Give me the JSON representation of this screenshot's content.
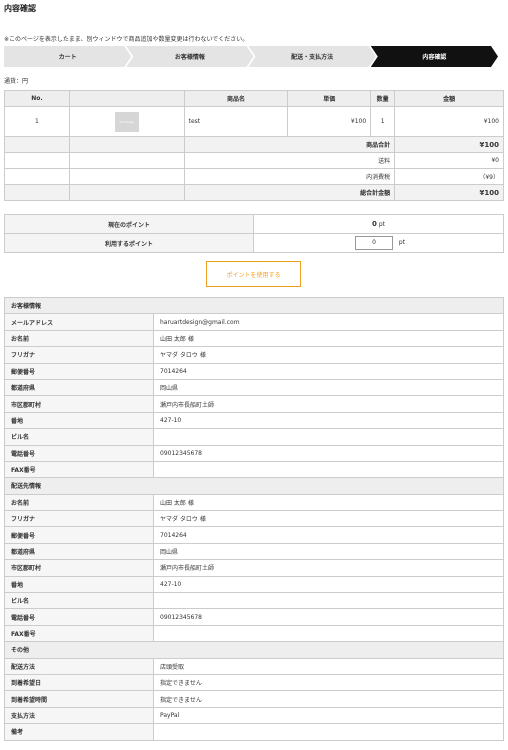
{
  "page_title": "内容確認",
  "notice": "※このページを表示したまま、別ウィンドウで商品追加や数量変更は行わないでください。",
  "steps": [
    "カート",
    "お客様情報",
    "配送・支払方法",
    "内容確認"
  ],
  "currency_note": "通貨：円",
  "items_table": {
    "headers": [
      "No.",
      "",
      "商品名",
      "単価",
      "数量",
      "金額"
    ],
    "rows": [
      {
        "no": "1",
        "image_text": "No Image",
        "name": "test",
        "unit_price": "¥100",
        "qty": "1",
        "amount": "¥100"
      }
    ],
    "summary": [
      {
        "label": "商品合計",
        "value": "¥100"
      },
      {
        "label": "送料",
        "value": "¥0"
      },
      {
        "label": "内消費税",
        "value": "（¥9）"
      },
      {
        "label": "総合計金額",
        "value": "¥100"
      }
    ]
  },
  "points": {
    "current_label": "現在のポイント",
    "current_value": "0",
    "unit": "pt",
    "use_label": "利用するポイント",
    "use_value": "0",
    "button_label": "ポイントを使用する"
  },
  "customer": {
    "section": "お客様情報",
    "rows": [
      {
        "k": "メールアドレス",
        "v": "haruartdesign@gmail.com"
      },
      {
        "k": "お名前",
        "v": "山田 太郎 様"
      },
      {
        "k": "フリガナ",
        "v": "ヤマダ タロウ 様"
      },
      {
        "k": "郵便番号",
        "v": "7014264"
      },
      {
        "k": "都道府県",
        "v": "岡山県"
      },
      {
        "k": "市区郡町村",
        "v": "瀬戸内市長船町土師"
      },
      {
        "k": "番地",
        "v": "427-10"
      },
      {
        "k": "ビル名",
        "v": ""
      },
      {
        "k": "電話番号",
        "v": "09012345678"
      },
      {
        "k": "FAX番号",
        "v": ""
      }
    ]
  },
  "shipping": {
    "section": "配送先情報",
    "rows": [
      {
        "k": "お名前",
        "v": "山田 太郎 様"
      },
      {
        "k": "フリガナ",
        "v": "ヤマダ タロウ 様"
      },
      {
        "k": "郵便番号",
        "v": "7014264"
      },
      {
        "k": "都道府県",
        "v": "岡山県"
      },
      {
        "k": "市区郡町村",
        "v": "瀬戸内市長船町土師"
      },
      {
        "k": "番地",
        "v": "427-10"
      },
      {
        "k": "ビル名",
        "v": ""
      },
      {
        "k": "電話番号",
        "v": "09012345678"
      },
      {
        "k": "FAX番号",
        "v": ""
      }
    ]
  },
  "other": {
    "section": "その他",
    "rows": [
      {
        "k": "配送方法",
        "v": "店頭受取"
      },
      {
        "k": "到着希望日",
        "v": "指定できません"
      },
      {
        "k": "到着希望時間",
        "v": "指定できません"
      },
      {
        "k": "支払方法",
        "v": "PayPal"
      },
      {
        "k": "備考",
        "v": ""
      }
    ]
  }
}
